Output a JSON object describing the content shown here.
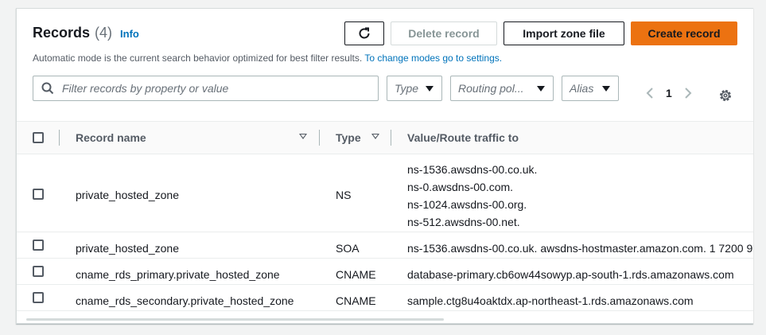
{
  "header": {
    "title": "Records",
    "count": "(4)",
    "info": "Info",
    "subtitle_text": "Automatic mode is the current search behavior optimized for best filter results. ",
    "subtitle_link": "To change modes go to settings."
  },
  "toolbar": {
    "refresh_icon": "refresh-icon",
    "delete_label": "Delete record",
    "import_label": "Import zone file",
    "create_label": "Create record",
    "accent_color": "#ec7211"
  },
  "filters": {
    "search_placeholder": "Filter records by property or value",
    "type_label": "Type",
    "routing_label": "Routing pol...",
    "alias_label": "Alias"
  },
  "pagination": {
    "current_page": "1"
  },
  "table": {
    "columns": {
      "record_name": "Record name",
      "type": "Type",
      "value": "Value/Route traffic to"
    },
    "rows": [
      {
        "name": "private_hosted_zone",
        "type": "NS",
        "values": [
          "ns-1536.awsdns-00.co.uk.",
          "ns-0.awsdns-00.com.",
          "ns-1024.awsdns-00.org.",
          "ns-512.awsdns-00.net."
        ]
      },
      {
        "name": "private_hosted_zone",
        "type": "SOA",
        "values": [
          "ns-1536.awsdns-00.co.uk. awsdns-hostmaster.amazon.com. 1 7200 9"
        ]
      },
      {
        "name": "cname_rds_primary.private_hosted_zone",
        "type": "CNAME",
        "values": [
          "database-primary.cb6ow44sowyp.ap-south-1.rds.amazonaws.com"
        ]
      },
      {
        "name": "cname_rds_secondary.private_hosted_zone",
        "type": "CNAME",
        "values": [
          "sample.ctg8u4oaktdx.ap-northeast-1.rds.amazonaws.com"
        ]
      }
    ]
  }
}
